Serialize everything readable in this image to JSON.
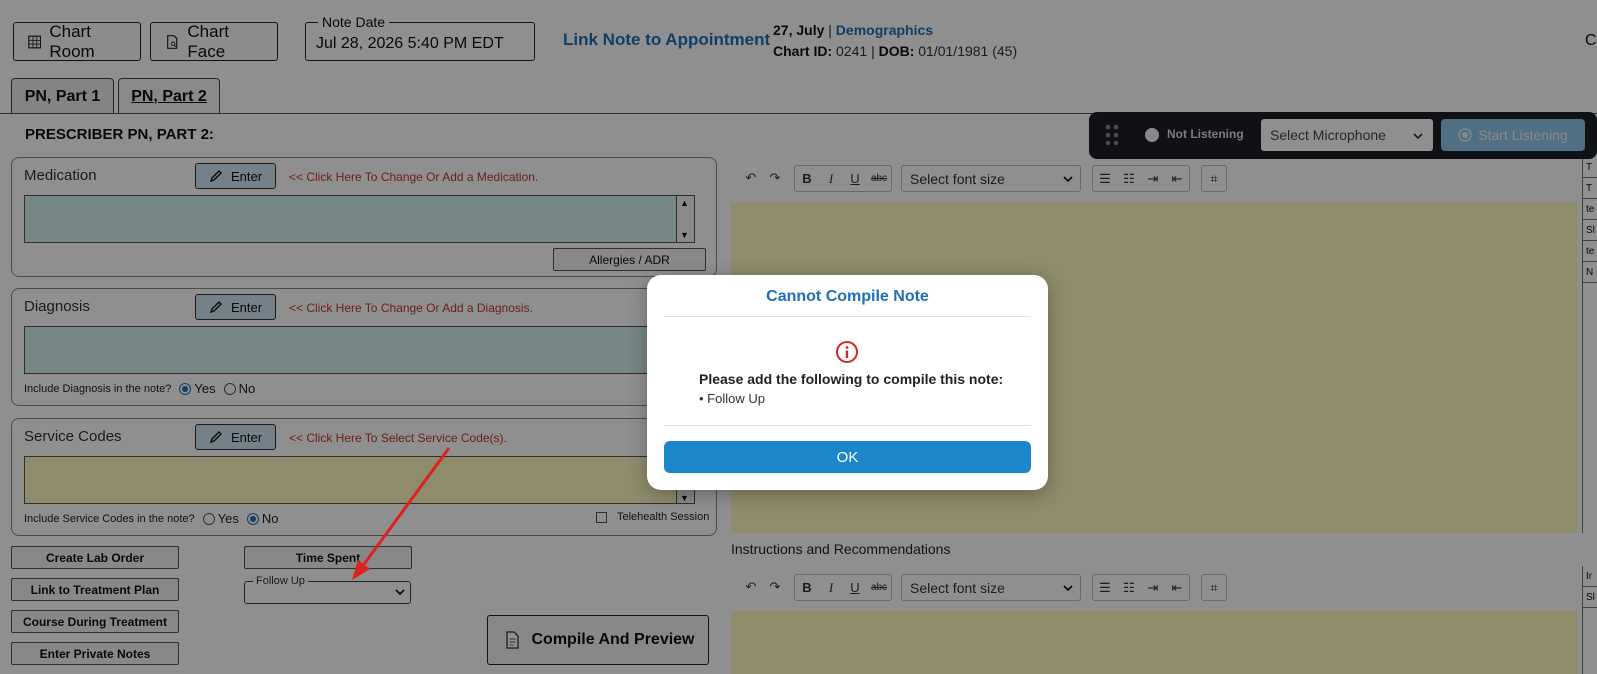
{
  "header": {
    "chart_room_label": "Chart Room",
    "chart_face_label": "Chart Face",
    "note_date_label": "Note Date",
    "note_date_value": "Jul 28, 2026 5:40 PM EDT",
    "link_appointment_label": "Link Note to Appointment",
    "patient_date": "27, July",
    "separator": "|",
    "demographics_label": "Demographics",
    "chart_id_label": "Chart ID:",
    "chart_id_value": "0241",
    "dob_label": "DOB:",
    "dob_value": "01/01/1981 (45)",
    "cut_off_text": "Co"
  },
  "tabs": [
    {
      "label": "PN, Part 1"
    },
    {
      "label": "PN, Part 2"
    }
  ],
  "section_title": "PRESCRIBER PN, PART 2:",
  "medication": {
    "label": "Medication",
    "enter_label": "Enter",
    "hint": "<< Click Here To Change Or Add a Medication.",
    "allergies_label": "Allergies / ADR"
  },
  "diagnosis": {
    "label": "Diagnosis",
    "enter_label": "Enter",
    "hint": "<< Click Here To Change Or Add a Diagnosis.",
    "include_label": "Include Diagnosis in the note?",
    "yes_label": "Yes",
    "no_label": "No"
  },
  "service_codes": {
    "label": "Service Codes",
    "enter_label": "Enter",
    "hint": "<< Click Here To Select Service Code(s).",
    "include_label": "Include Service Codes in the note?",
    "yes_label": "Yes",
    "no_label": "No",
    "telehealth_label": "Telehealth Session"
  },
  "actions": {
    "create_lab_order": "Create Lab Order",
    "link_treatment_plan": "Link to Treatment Plan",
    "course_during_treatment": "Course During Treatment",
    "enter_private_notes": "Enter Private Notes",
    "time_spent": "Time Spent",
    "follow_up_label": "Follow Up",
    "compile_preview": "Compile And Preview"
  },
  "editors": {
    "font_size_placeholder": "Select font size",
    "instructions_label": "Instructions and Recommendations"
  },
  "side_strip": [
    "T",
    "T",
    "te",
    "Sl",
    "te",
    "N"
  ],
  "side_strip_2": [
    "Ir",
    "Sl"
  ],
  "voice": {
    "status": "Not Listening",
    "mic_placeholder": "Select Microphone",
    "start_label": "Start Listening"
  },
  "modal": {
    "title": "Cannot Compile Note",
    "message": "Please add the following to compile this note:",
    "item": "• Follow Up",
    "ok_label": "OK"
  },
  "colors": {
    "accent_blue": "#1f6fb8",
    "modal_button": "#1b87c9",
    "hint_red": "#c0392b",
    "field_teal": "#d4f0ee",
    "field_yellow": "#fff9bf",
    "voice_bar": "#1b1f24"
  }
}
